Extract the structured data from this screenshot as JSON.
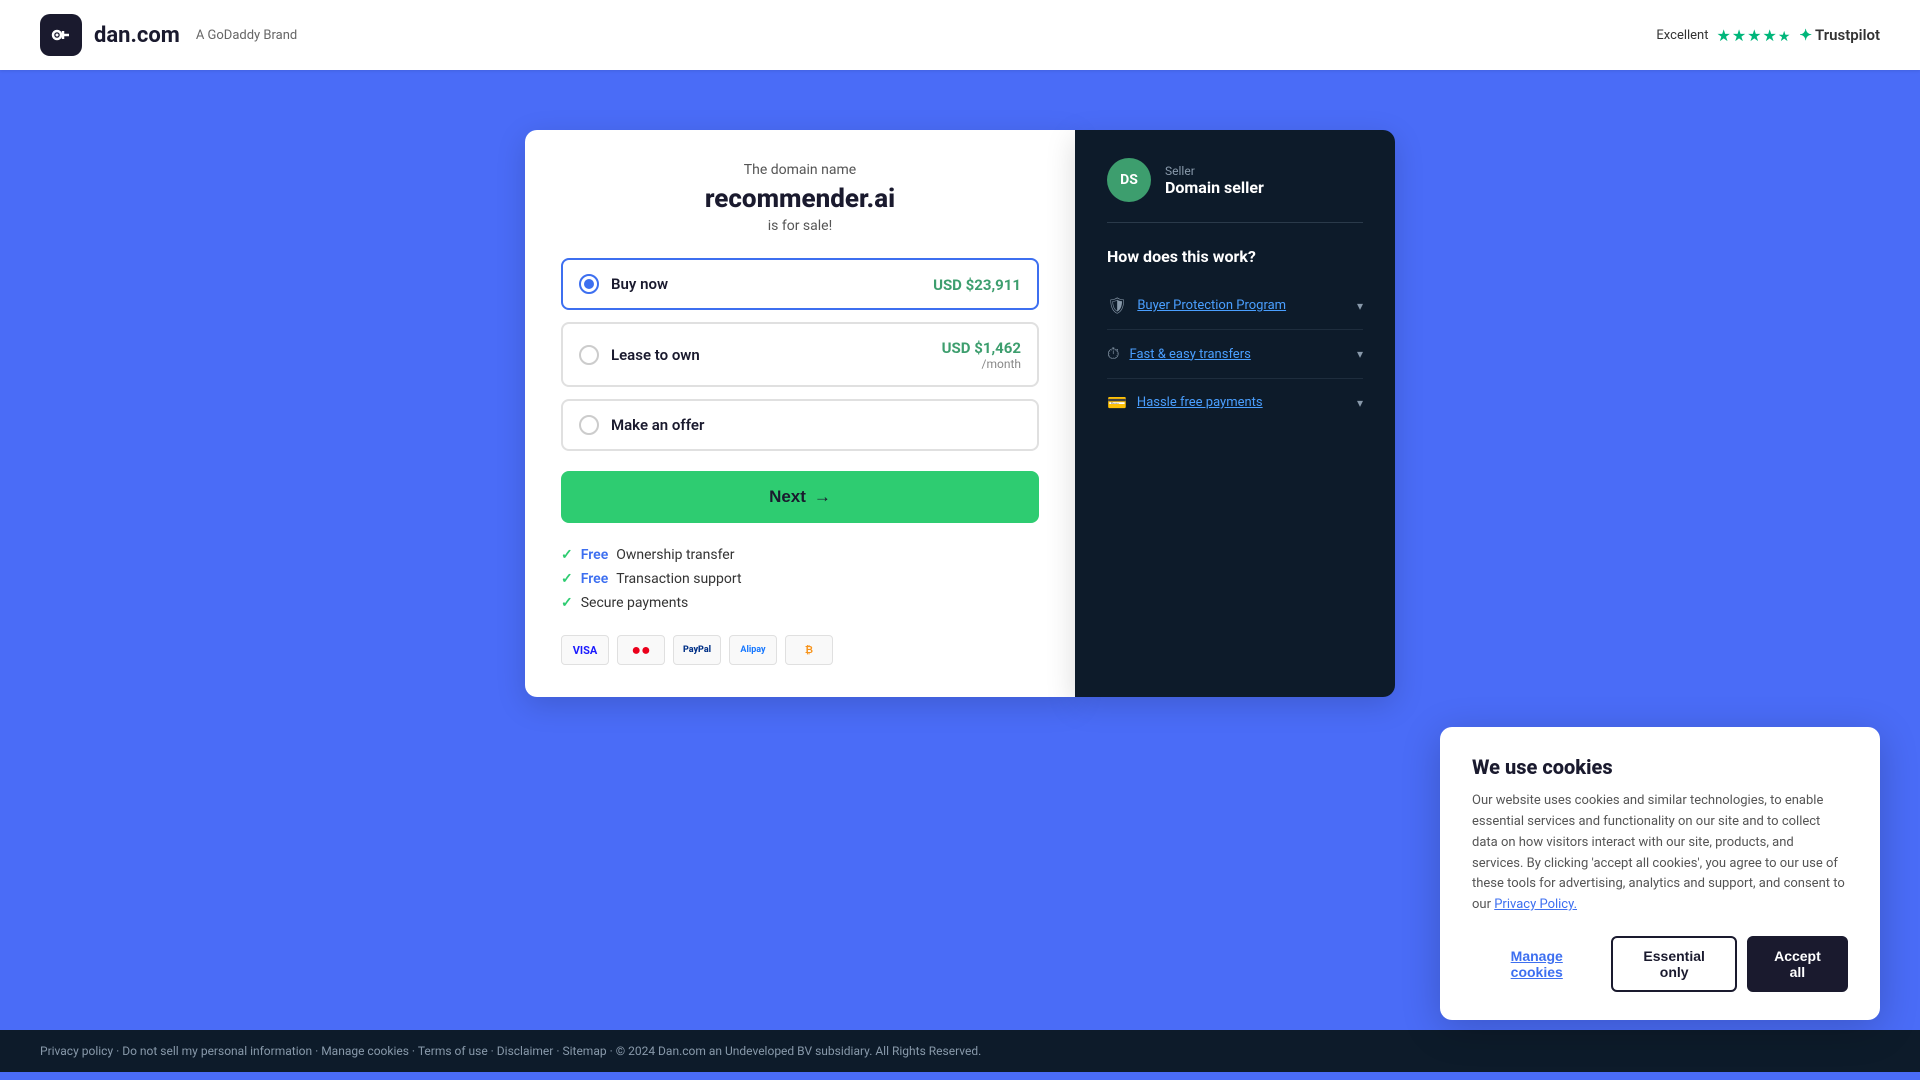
{
  "header": {
    "logo_icon": "d",
    "logo_text": "dan.com",
    "godaddy_text": "A GoDaddy Brand",
    "trustpilot_label": "Excellent",
    "trustpilot_stars": "★★★★½",
    "trustpilot_brand": "Trustpilot"
  },
  "domain_card": {
    "domain_label": "The domain name",
    "domain_name": "recommender.ai",
    "for_sale": "is for sale!",
    "options": [
      {
        "id": "buy_now",
        "label": "Buy now",
        "price": "USD $23,911",
        "price_sub": "",
        "selected": true
      },
      {
        "id": "lease_to_own",
        "label": "Lease to own",
        "price": "USD $1,462",
        "price_sub": "/month",
        "selected": false
      },
      {
        "id": "make_offer",
        "label": "Make an offer",
        "price": "",
        "price_sub": "",
        "selected": false
      }
    ],
    "next_button": "Next",
    "features": [
      {
        "free": true,
        "text": "Ownership transfer"
      },
      {
        "free": true,
        "text": "Transaction support"
      },
      {
        "free": false,
        "text": "Secure payments"
      }
    ],
    "payment_methods": [
      "VISA",
      "MC",
      "PayPal",
      "Alipay",
      "BTC"
    ]
  },
  "seller_card": {
    "avatar_initials": "DS",
    "seller_role": "Seller",
    "seller_name": "Domain seller",
    "how_works_title": "How does this work?",
    "info_rows": [
      {
        "icon": "🛡",
        "label": "Buyer Protection Program"
      },
      {
        "icon": "⏱",
        "label": "Fast & easy transfers"
      },
      {
        "icon": "💳",
        "label": "Hassle free payments"
      }
    ]
  },
  "cookie_banner": {
    "title": "We use cookies",
    "text": "Our website uses cookies and similar technologies, to enable essential services and functionality on our site and to collect data on how visitors interact with our site, products, and services. By clicking 'accept all cookies', you agree to our use of these tools for advertising, analytics and support, and consent to our",
    "privacy_link": "Privacy Policy.",
    "btn_manage": "Manage cookies",
    "btn_essential": "Essential only",
    "btn_accept": "Accept all"
  },
  "footer": {
    "links": [
      "Privacy policy",
      "Do not sell my personal information",
      "Manage cookies",
      "Terms of use",
      "Disclaimer",
      "Sitemap"
    ],
    "copyright": "© 2024 Dan.com an Undeveloped BV subsidiary. All Rights Reserved."
  }
}
